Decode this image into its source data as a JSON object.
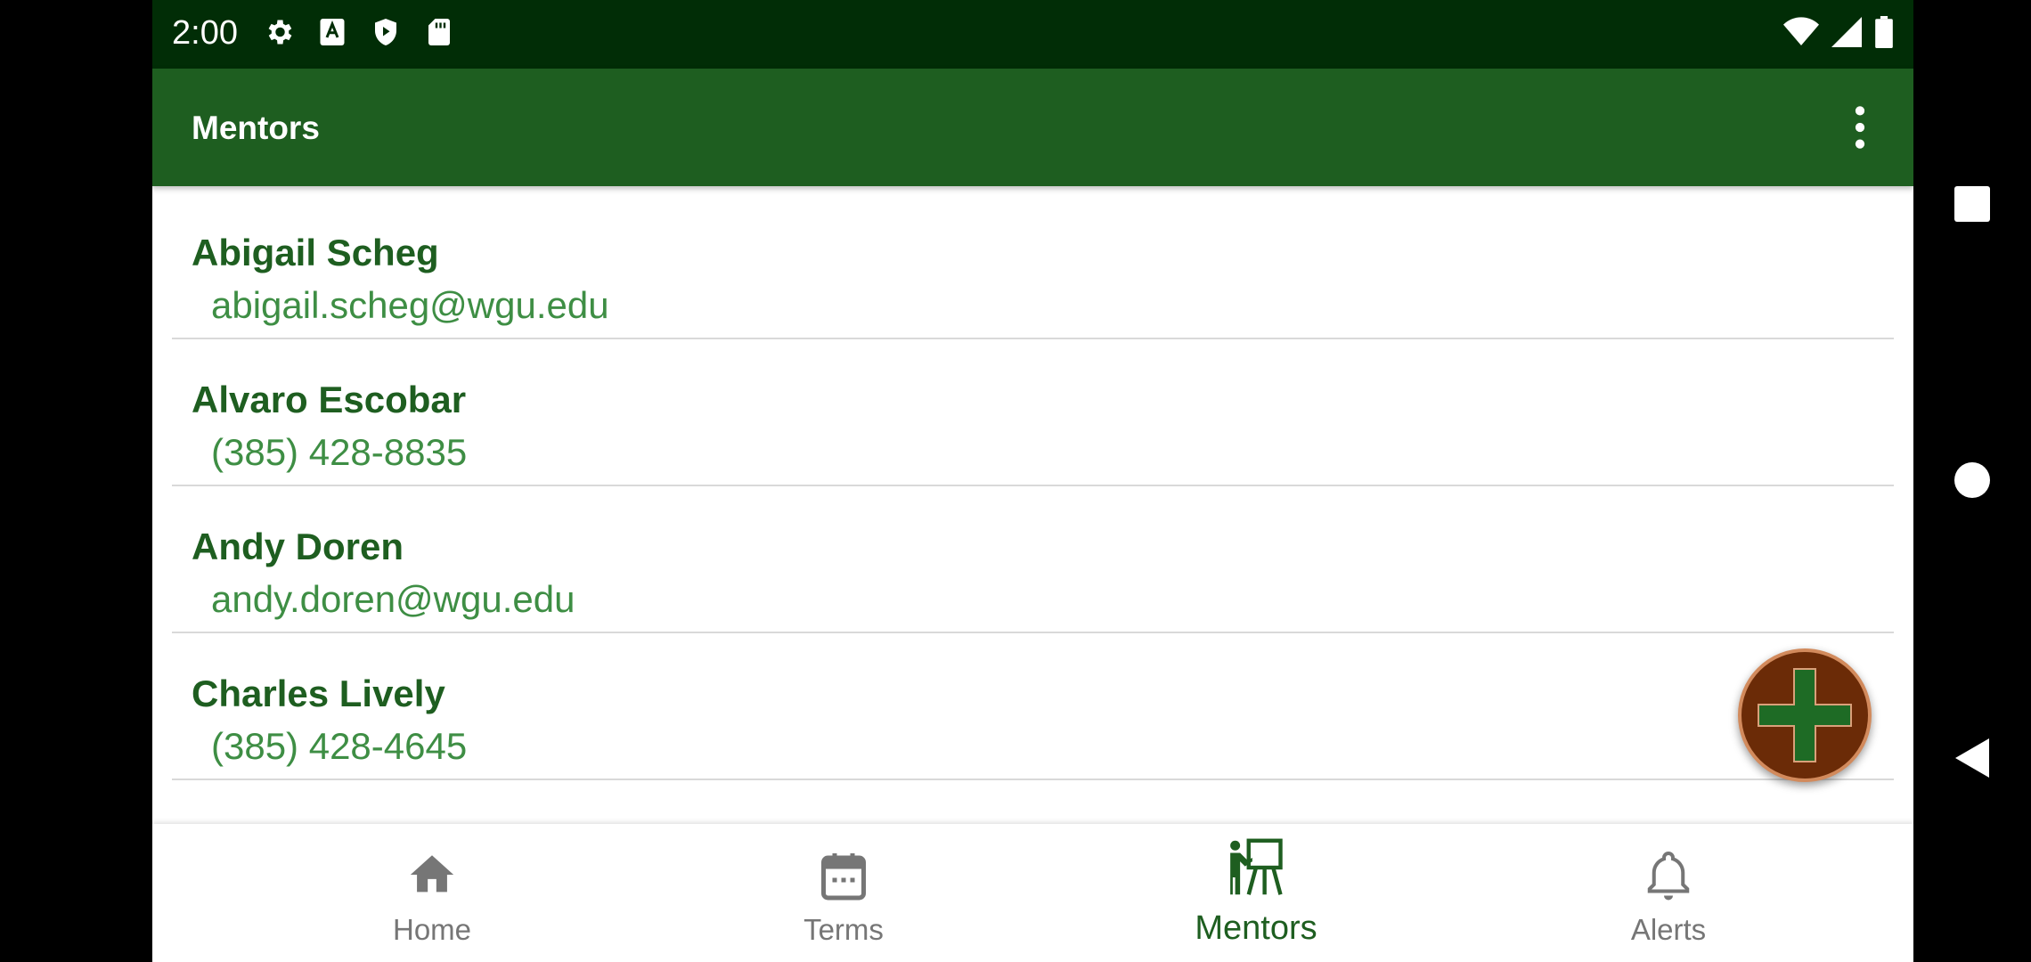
{
  "status_bar": {
    "time": "2:00",
    "left_icons": [
      "gear-icon",
      "font-a-icon",
      "shield-play-icon",
      "sd-card-icon"
    ],
    "right_icons": [
      "wifi-icon",
      "cell-signal-icon",
      "battery-icon"
    ]
  },
  "app_bar": {
    "title": "Mentors",
    "menu_icon": "more-vert-icon"
  },
  "mentors": [
    {
      "name": "Abigail Scheg",
      "contact": "abigail.scheg@wgu.edu"
    },
    {
      "name": "Alvaro Escobar",
      "contact": "(385) 428-8835"
    },
    {
      "name": "Andy Doren",
      "contact": "andy.doren@wgu.edu"
    },
    {
      "name": "Charles Lively",
      "contact": "(385) 428-4645"
    }
  ],
  "fab": {
    "icon": "plus-icon"
  },
  "bottom_nav": {
    "items": [
      {
        "label": "Home",
        "icon": "home-icon",
        "active": false
      },
      {
        "label": "Terms",
        "icon": "calendar-icon",
        "active": false
      },
      {
        "label": "Mentors",
        "icon": "mentor-presentation-icon",
        "active": true
      },
      {
        "label": "Alerts",
        "icon": "bell-icon",
        "active": false
      }
    ]
  },
  "system_nav": [
    "recents-square-icon",
    "home-circle-icon",
    "back-triangle-icon"
  ],
  "colors": {
    "status_bar": "#012d06",
    "app_bar": "#1e5e20",
    "name_text": "#1e5e20",
    "contact_text": "#3e8e44",
    "fab": "#6b2b07",
    "inactive_nav": "#767676"
  }
}
